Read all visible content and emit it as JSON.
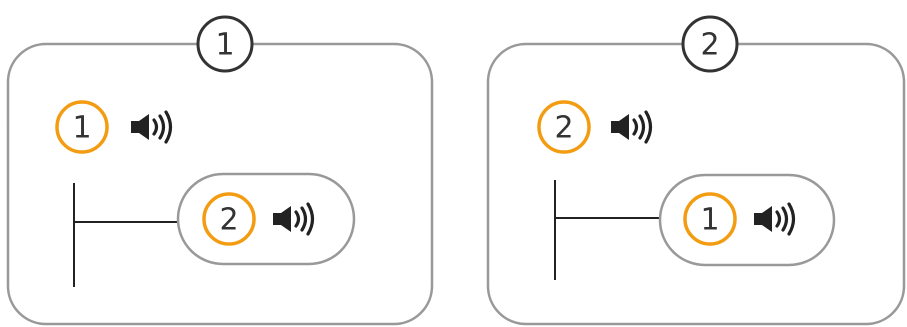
{
  "colors": {
    "frame_stroke": "#999999",
    "header_circle_stroke": "#333333",
    "orange_accent": "#F39C12",
    "line": "#222222",
    "icon": "#222222"
  },
  "panels": [
    {
      "header_number": "1",
      "outer_item": {
        "number": "1",
        "icon": "speaker-icon"
      },
      "nested_item": {
        "number": "2",
        "icon": "speaker-icon"
      }
    },
    {
      "header_number": "2",
      "outer_item": {
        "number": "2",
        "icon": "speaker-icon"
      },
      "nested_item": {
        "number": "1",
        "icon": "speaker-icon"
      }
    }
  ]
}
